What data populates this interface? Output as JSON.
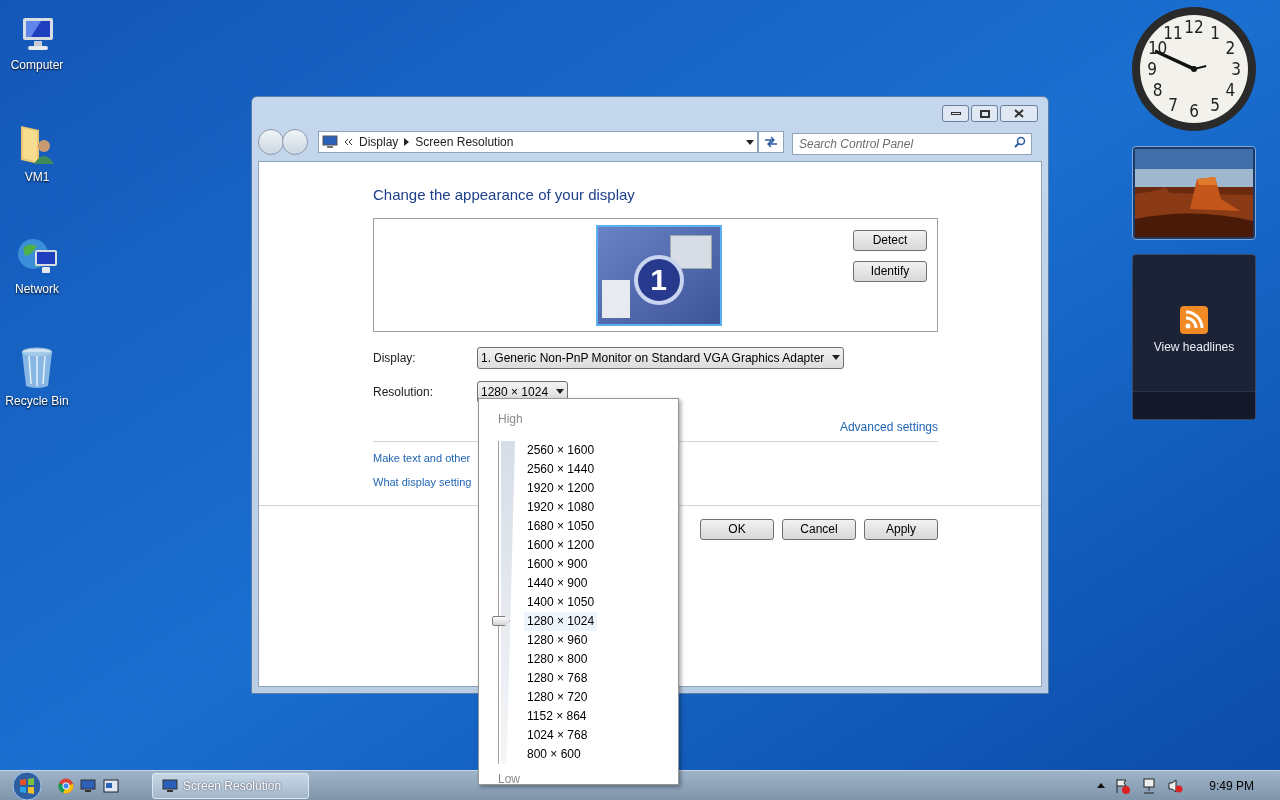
{
  "desktop_icons": [
    {
      "label": "Computer",
      "kind": "computer"
    },
    {
      "label": "VM1",
      "kind": "user-folder"
    },
    {
      "label": "Network",
      "kind": "network"
    },
    {
      "label": "Recycle Bin",
      "kind": "recycle-bin"
    }
  ],
  "clock": {
    "numerals": [
      "12",
      "11",
      "1",
      "10",
      "2",
      "9",
      "3",
      "8",
      "4",
      "7",
      "5",
      "6"
    ]
  },
  "feed_gadget": {
    "label": "View headlines"
  },
  "window": {
    "breadcrumb": [
      "Display",
      "Screen Resolution"
    ],
    "search": {
      "placeholder": "Search Control Panel"
    },
    "heading": "Change the appearance of your display",
    "monitor_number": "1",
    "preview_buttons": [
      "Detect",
      "Identify"
    ],
    "fields": [
      {
        "label": "Display:",
        "value": "1. Generic Non-PnP Monitor on Standard VGA Graphics Adapter"
      },
      {
        "label": "Resolution:",
        "value": "1280 × 1024"
      }
    ],
    "advanced_link": "Advanced settings",
    "links": [
      "Make text and other",
      "What display setting"
    ],
    "buttons": [
      "OK",
      "Cancel",
      "Apply"
    ]
  },
  "resolution_menu": {
    "top_label": "High",
    "bottom_label": "Low",
    "options": [
      {
        "label": "2560 × 1600",
        "selected": false
      },
      {
        "label": "2560 × 1440",
        "selected": false
      },
      {
        "label": "1920 × 1200",
        "selected": false
      },
      {
        "label": "1920 × 1080",
        "selected": false
      },
      {
        "label": "1680 × 1050",
        "selected": false
      },
      {
        "label": "1600 × 1200",
        "selected": false
      },
      {
        "label": "1600 × 900",
        "selected": false
      },
      {
        "label": "1440 × 900",
        "selected": false
      },
      {
        "label": "1400 × 1050",
        "selected": false
      },
      {
        "label": "1280 × 1024",
        "selected": true
      },
      {
        "label": "1280 × 960",
        "selected": false
      },
      {
        "label": "1280 × 800",
        "selected": false
      },
      {
        "label": "1280 × 768",
        "selected": false
      },
      {
        "label": "1280 × 720",
        "selected": false
      },
      {
        "label": "1152 × 864",
        "selected": false
      },
      {
        "label": "1024 × 768",
        "selected": false
      },
      {
        "label": "800 × 600",
        "selected": false
      }
    ]
  },
  "taskbar": {
    "task_button": "Screen Resolution",
    "time": "9:49 PM"
  }
}
